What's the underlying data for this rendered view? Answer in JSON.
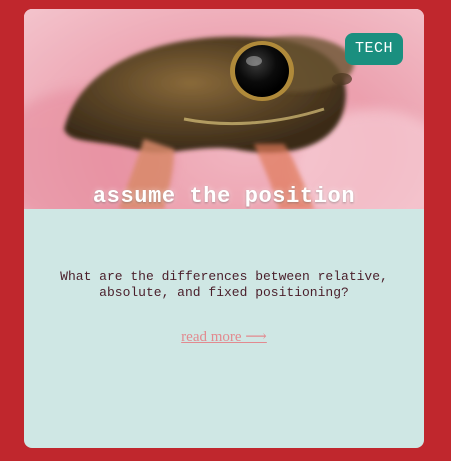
{
  "card": {
    "tag": "TECH",
    "title": "assume the position",
    "description": "What are the differences between relative, absolute, and fixed positioning?",
    "read_more": "read more ⟶"
  },
  "colors": {
    "page_background": "#c0272d",
    "card_body": "#cfe7e4",
    "tag_background": "#1a8f7f",
    "link": "#e28a8f",
    "description_text": "#4a1e2a"
  },
  "hero_image": {
    "subject": "frog"
  }
}
